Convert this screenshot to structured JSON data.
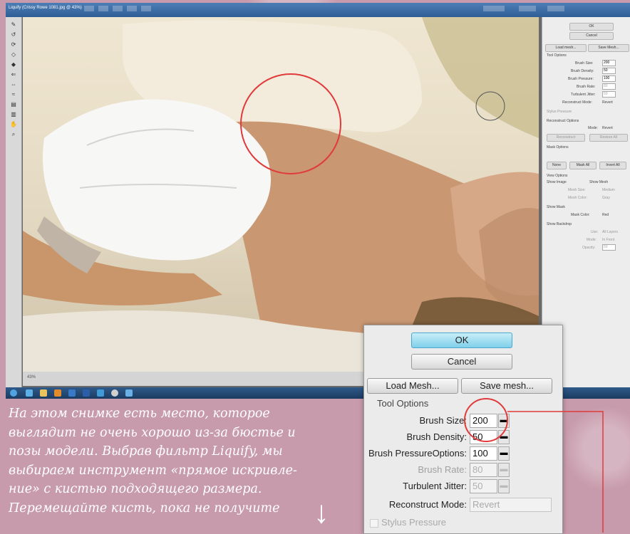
{
  "window": {
    "title": "Liquify (Crissy Rowe 1081.jpg @ 43%)"
  },
  "side_panel": {
    "ok": "OK",
    "cancel": "Cancel",
    "load_mesh": "Load mesh...",
    "save_mesh": "Save Mesh...",
    "tool_options": "Tool Options",
    "brush_size": {
      "label": "Brush Size:",
      "value": "200"
    },
    "brush_density": {
      "label": "Brush Density:",
      "value": "50"
    },
    "brush_pressure": {
      "label": "Brush Pressure:",
      "value": "100"
    },
    "brush_rate": {
      "label": "Brush Rate:",
      "value": "80"
    },
    "turbulent_jitter": {
      "label": "Turbulent Jitter:",
      "value": "50"
    },
    "reconstruct_mode": {
      "label": "Reconstruct Mode:",
      "value": "Revert"
    },
    "stylus_pressure": "Stylus Pressure",
    "reconstruct_options": "Reconstruct Options",
    "mode": {
      "label": "Mode:",
      "value": "Revert"
    },
    "reconstruct_btn": "Reconstruct",
    "restore_all_btn": "Restore All",
    "mask_options": "Mask Options",
    "none_btn": "None",
    "mask_all_btn": "Mask All",
    "invert_all_btn": "Invert All",
    "view_options": "View Options",
    "show_image": "Show Image",
    "show_mesh": "Show Mesh",
    "mesh_size": {
      "label": "Mesh Size:",
      "value": "Medium"
    },
    "mesh_color": {
      "label": "Mesh Color:",
      "value": "Gray"
    },
    "show_mask": "Show Mask",
    "mask_color": {
      "label": "Mask Color:",
      "value": "Red"
    },
    "show_backdrop": "Show Backdrop",
    "use": {
      "label": "Use:",
      "value": "All Layers"
    },
    "backdrop_mode": {
      "label": "Mode:",
      "value": "In Front"
    },
    "opacity": {
      "label": "Opacity:",
      "value": "50"
    }
  },
  "status_bar": {
    "zoom": "43%"
  },
  "zoom_inset": {
    "ok": "OK",
    "cancel": "Cancel",
    "load_mesh": "Load Mesh...",
    "save_mesh": "Save mesh...",
    "tool_options": "Tool Options",
    "brush_size": {
      "label": "Brush Size:",
      "value": "200"
    },
    "brush_density": {
      "label": "Brush Density:",
      "value": "50"
    },
    "brush_pressure": {
      "label": "Brush PressureOptions:",
      "value": "100"
    },
    "brush_rate": {
      "label": "Brush Rate:",
      "value": "80"
    },
    "turbulent_jitter": {
      "label": "Turbulent Jitter:",
      "value": "50"
    },
    "reconstruct_mode": {
      "label": "Reconstruct Mode:",
      "value": "Revert"
    },
    "stylus_pressure": "Stylus Pressure"
  },
  "caption": "На этом снимке есть место, которое\nвыглядит не очень хорошо из-за бюстье и\nпозы модели. Выбрав фильтр Liquify, мы\nвыбираем инструмент «прямое искривле-\nние» с кистью подходящего размера.\nПеремещайте кисть, пока не получите",
  "colors": {
    "highlight_circle": "#e03a3a",
    "background": "#c79bab",
    "ok_button": "#7fd0ea"
  }
}
